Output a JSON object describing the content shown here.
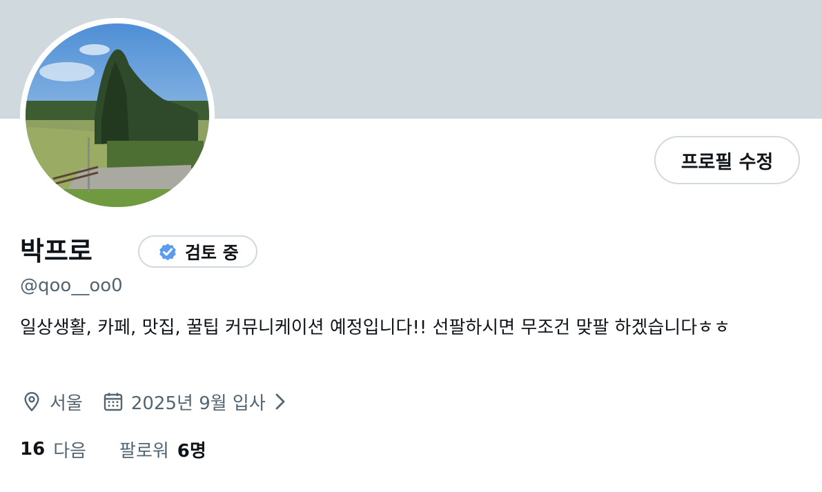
{
  "profile": {
    "name": "박프로",
    "verify_label": "검토 중",
    "handle": "@qoo__oo0",
    "bio": "일상생활, 카페, 맛집, 꿀팁 커뮤니케이션 예정입니다!! 선팔하시면 무조건 맞팔 하겠습니다ㅎㅎ",
    "location": "서울",
    "joined": "2025년 9월 입사"
  },
  "buttons": {
    "edit_profile": "프로필 수정"
  },
  "stats": {
    "following_count": "16",
    "following_label": "다음",
    "followers_label": "팔로워",
    "followers_count": "6명"
  },
  "icons": {
    "verify": "verified-badge-icon",
    "location": "location-pin-icon",
    "calendar": "calendar-icon",
    "chevron": "chevron-right-icon"
  },
  "colors": {
    "banner": "#cfd9de",
    "verified": "#5b9cf0",
    "secondary_text": "#536471",
    "primary_text": "#0f1419"
  }
}
